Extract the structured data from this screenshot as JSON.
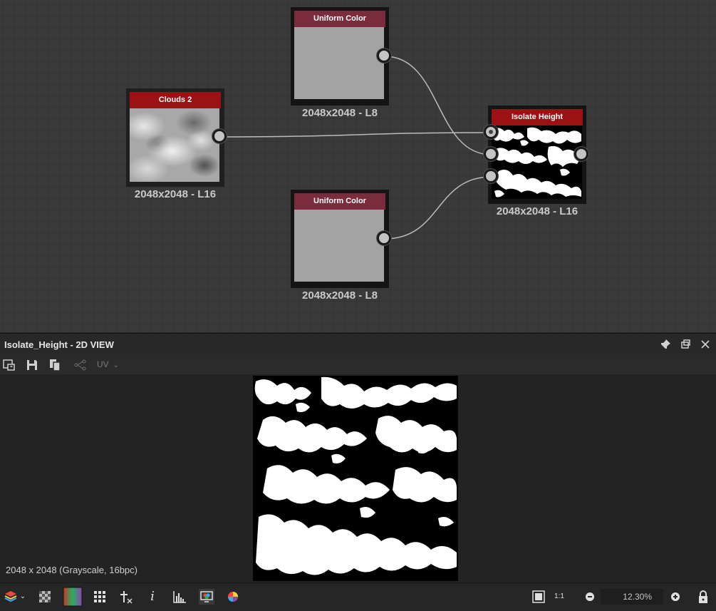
{
  "graph": {
    "nodes": {
      "clouds": {
        "title": "Clouds 2",
        "caption": "2048x2048 - L16"
      },
      "uniform_top": {
        "title": "Uniform Color",
        "caption": "2048x2048 - L8"
      },
      "uniform_bottom": {
        "title": "Uniform Color",
        "caption": "2048x2048 - L8"
      },
      "isolate": {
        "title": "Isolate Height",
        "caption": "2048x2048 - L16"
      }
    }
  },
  "view": {
    "title": "Isolate_Height - 2D VIEW",
    "uv_label": "UV",
    "resolution_info": "2048 x 2048 (Grayscale, 16bpc)",
    "zoom": "12.30%"
  },
  "colors": {
    "node_title_red": "#9b1114",
    "node_title_maroon": "#7a2c3d",
    "graph_background": "#3a3a3a",
    "panel_background": "#232323"
  },
  "icons": [
    "pin-icon",
    "maximize-icon",
    "close-icon",
    "export-image-icon",
    "save-icon",
    "copy-icon",
    "graph-link-icon",
    "layers-icon",
    "checker-background-icon",
    "color-gradient-icon",
    "grid-tiling-icon",
    "transform-tool-icon",
    "info-icon",
    "histogram-icon",
    "display-settings-icon",
    "color-wheel-icon",
    "fit-view-icon",
    "zoom-1-to-1-icon",
    "zoom-out-icon",
    "zoom-in-icon",
    "lock-icon"
  ]
}
